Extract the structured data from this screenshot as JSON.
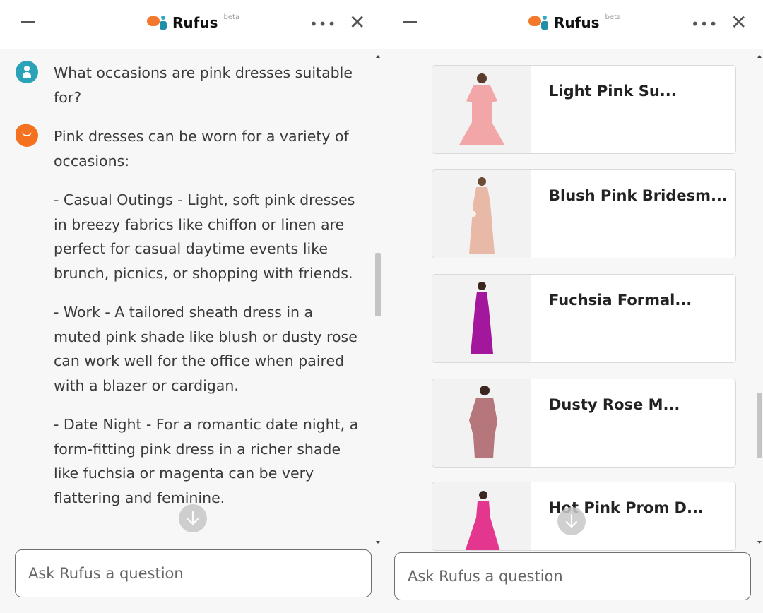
{
  "panels": [
    {
      "header": {
        "brand": "Rufus",
        "beta": "beta",
        "more_icon": "more-icon",
        "close_icon": "close-icon"
      },
      "messages": [
        {
          "role": "user",
          "text": "What occasions are pink dresses suitable for?"
        },
        {
          "role": "assistant",
          "paragraphs": [
            "Pink dresses can be worn for a variety of occasions:",
            "- Casual Outings - Light, soft pink dresses in breezy fabrics like chiffon or linen are perfect for casual daytime events like brunch, picnics, or shopping with friends.",
            "- Work - A tailored sheath dress in a muted pink shade like blush or dusty rose can work well for the office when paired with a blazer or cardigan.",
            "- Date Night - For a romantic date night, a form-fitting pink dress in a richer shade like fuchsia or magenta can be very flattering and feminine."
          ]
        }
      ],
      "input": {
        "placeholder": "Ask Rufus a question"
      }
    },
    {
      "header": {
        "brand": "Rufus",
        "beta": "beta",
        "more_icon": "more-icon",
        "close_icon": "close-icon"
      },
      "products": [
        {
          "title": "Light Pink Su...",
          "color": "#f2a6a8"
        },
        {
          "title": "Blush Pink Bridesm...",
          "color": "#e9b9a8"
        },
        {
          "title": "Fuchsia Formal...",
          "color": "#a3179c"
        },
        {
          "title": "Dusty Rose M...",
          "color": "#b5767c"
        },
        {
          "title": "Hot Pink Prom D...",
          "color": "#e3378f"
        }
      ],
      "input": {
        "placeholder": "Ask Rufus a question"
      }
    }
  ],
  "icons": {
    "scroll_down": "arrow-down-icon"
  }
}
